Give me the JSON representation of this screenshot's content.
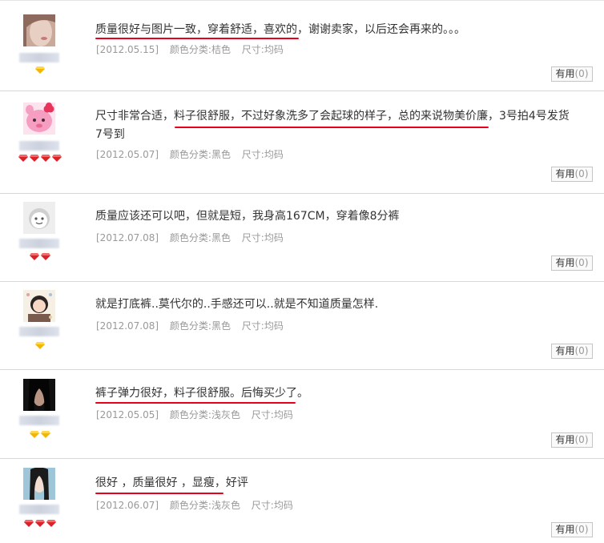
{
  "reviews": [
    {
      "content": "质量很好与图片一致，穿着舒适，喜欢的，谢谢卖家，以后还会再来的。。。",
      "date": "[2012.05.15]",
      "color": "颜色分类:桔色",
      "size": "尺寸:均码",
      "useful_label": "有用",
      "useful_count": "(0)",
      "badge_type": "yellow-diamond",
      "badge_count": 1,
      "avatar": "woman-portrait"
    },
    {
      "content": "尺寸非常合适，料子很舒服，不过好象洗多了会起球的样子，总的来说物美价廉，3号拍4号发货7号到",
      "date": "[2012.05.07]",
      "color": "颜色分类:黑色",
      "size": "尺寸:均码",
      "useful_label": "有用",
      "useful_count": "(0)",
      "badge_type": "red-heart",
      "badge_count": 4,
      "avatar": "pink-cartoon"
    },
    {
      "content": "质量应该还可以吧，但就是短，我身高167CM，穿着像8分裤",
      "date": "[2012.07.08]",
      "color": "颜色分类:黑色",
      "size": "尺寸:均码",
      "useful_label": "有用",
      "useful_count": "(0)",
      "badge_type": "red-heart",
      "badge_count": 2,
      "avatar": "default-face"
    },
    {
      "content": "就是打底裤..莫代尔的..手感还可以..就是不知道质量怎样.",
      "date": "[2012.07.08]",
      "color": "颜色分类:黑色",
      "size": "尺寸:均码",
      "useful_label": "有用",
      "useful_count": "(0)",
      "badge_type": "yellow-diamond",
      "badge_count": 1,
      "avatar": "cartoon-girl"
    },
    {
      "content": "裤子弹力很好，料子很舒服。后悔买少了。",
      "date": "[2012.05.05]",
      "color": "颜色分类:浅灰色",
      "size": "尺寸:均码",
      "useful_label": "有用",
      "useful_count": "(0)",
      "badge_type": "yellow-diamond",
      "badge_count": 2,
      "avatar": "dark-hair"
    },
    {
      "content": "很好 ，质量很好 ，显瘦，好评",
      "date": "[2012.06.07]",
      "color": "颜色分类:浅灰色",
      "size": "尺寸:均码",
      "useful_label": "有用",
      "useful_count": "(0)",
      "badge_type": "red-heart",
      "badge_count": 3,
      "avatar": "girl-photo"
    }
  ],
  "colors": {
    "underline": "#e8001c",
    "meta_text": "#999999",
    "border": "#d8d8d8"
  }
}
